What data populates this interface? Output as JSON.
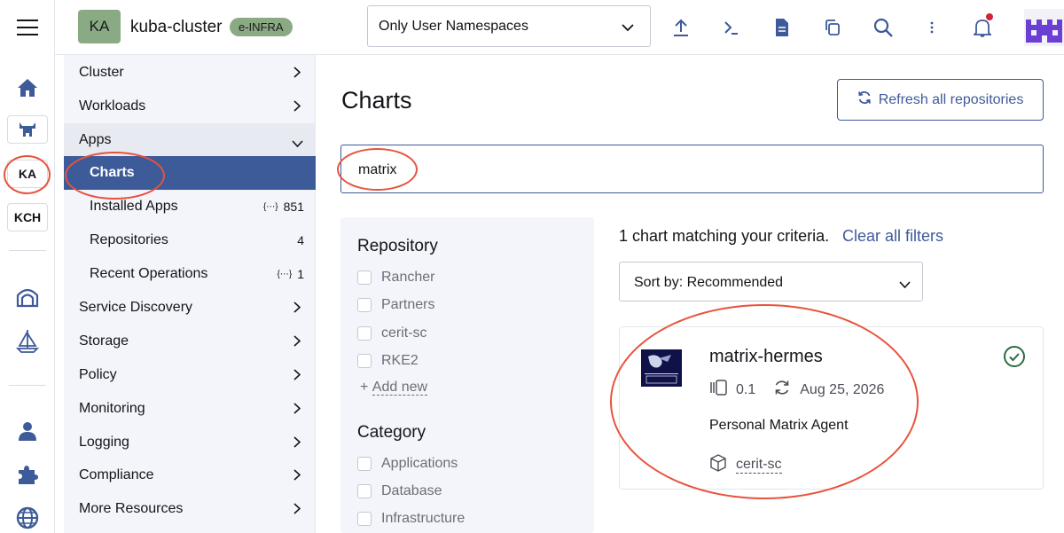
{
  "rail": {
    "items": [
      {
        "name": "home-icon"
      },
      {
        "name": "cluster-icon"
      },
      {
        "label": "KA"
      },
      {
        "label": "KCH"
      },
      {
        "name": "fleet-icon"
      },
      {
        "name": "apps-icon"
      },
      {
        "name": "user-icon"
      },
      {
        "name": "extensions-icon"
      },
      {
        "name": "globe-icon"
      }
    ]
  },
  "header": {
    "cluster_initials": "KA",
    "cluster_name": "kuba-cluster",
    "cluster_badge": "e-INFRA",
    "namespace_filter": "Only User Namespaces",
    "icons": [
      "upload-icon",
      "shell-icon",
      "file-icon",
      "copy-icon",
      "search-icon",
      "more-icon",
      "bell-icon"
    ]
  },
  "nav": {
    "items": [
      {
        "label": "Cluster"
      },
      {
        "label": "Workloads"
      },
      {
        "label": "Apps"
      },
      {
        "label": "Charts"
      },
      {
        "label": "Installed Apps",
        "count": "851"
      },
      {
        "label": "Repositories",
        "count": "4"
      },
      {
        "label": "Recent Operations",
        "count": "1"
      },
      {
        "label": "Service Discovery"
      },
      {
        "label": "Storage"
      },
      {
        "label": "Policy"
      },
      {
        "label": "Monitoring"
      },
      {
        "label": "Logging"
      },
      {
        "label": "Compliance"
      },
      {
        "label": "More Resources"
      }
    ]
  },
  "main": {
    "title": "Charts",
    "refresh_label": "Refresh all repositories",
    "search_value": "matrix",
    "filters": {
      "repository_heading": "Repository",
      "repositories": [
        "Rancher",
        "Partners",
        "cerit-sc",
        "RKE2"
      ],
      "add_new": "Add new",
      "category_heading": "Category",
      "categories": [
        "Applications",
        "Database",
        "Infrastructure"
      ]
    },
    "matching_text": "1 chart matching your criteria.",
    "clear_filters": "Clear all filters",
    "sort_label": "Sort by: Recommended",
    "chart": {
      "name": "matrix-hermes",
      "version": "0.1",
      "date": "Aug 25, 2026",
      "description": "Personal Matrix Agent",
      "repo": "cerit-sc"
    }
  },
  "colors": {
    "accent": "#3d5a99",
    "cluster_badge": "#8aaa84",
    "annotation": "#e8523d",
    "installed": "#2c6b3f"
  }
}
